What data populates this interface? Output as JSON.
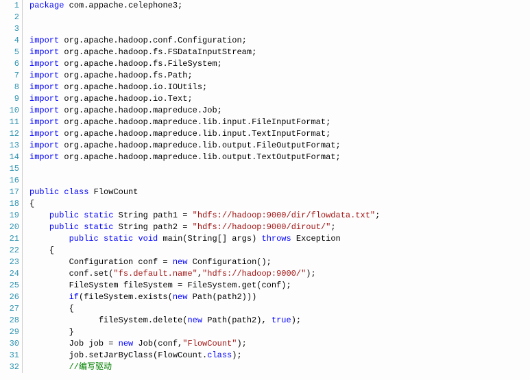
{
  "lines": [
    {
      "n": "1",
      "tokens": [
        [
          "kw",
          "package"
        ],
        [
          "id",
          " com.appache.celephone3;"
        ]
      ]
    },
    {
      "n": "2",
      "tokens": []
    },
    {
      "n": "3",
      "tokens": []
    },
    {
      "n": "4",
      "tokens": [
        [
          "kw",
          "import"
        ],
        [
          "id",
          " org.apache.hadoop.conf.Configuration;"
        ]
      ]
    },
    {
      "n": "5",
      "tokens": [
        [
          "kw",
          "import"
        ],
        [
          "id",
          " org.apache.hadoop.fs.FSDataInputStream;"
        ]
      ]
    },
    {
      "n": "6",
      "tokens": [
        [
          "kw",
          "import"
        ],
        [
          "id",
          " org.apache.hadoop.fs.FileSystem;"
        ]
      ]
    },
    {
      "n": "7",
      "tokens": [
        [
          "kw",
          "import"
        ],
        [
          "id",
          " org.apache.hadoop.fs.Path;"
        ]
      ]
    },
    {
      "n": "8",
      "tokens": [
        [
          "kw",
          "import"
        ],
        [
          "id",
          " org.apache.hadoop.io.IOUtils;"
        ]
      ]
    },
    {
      "n": "9",
      "tokens": [
        [
          "kw",
          "import"
        ],
        [
          "id",
          " org.apache.hadoop.io.Text;"
        ]
      ]
    },
    {
      "n": "10",
      "tokens": [
        [
          "kw",
          "import"
        ],
        [
          "id",
          " org.apache.hadoop.mapreduce.Job;"
        ]
      ]
    },
    {
      "n": "11",
      "tokens": [
        [
          "kw",
          "import"
        ],
        [
          "id",
          " org.apache.hadoop.mapreduce.lib.input.FileInputFormat;"
        ]
      ]
    },
    {
      "n": "12",
      "tokens": [
        [
          "kw",
          "import"
        ],
        [
          "id",
          " org.apache.hadoop.mapreduce.lib.input.TextInputFormat;"
        ]
      ]
    },
    {
      "n": "13",
      "tokens": [
        [
          "kw",
          "import"
        ],
        [
          "id",
          " org.apache.hadoop.mapreduce.lib.output.FileOutputFormat;"
        ]
      ]
    },
    {
      "n": "14",
      "tokens": [
        [
          "kw",
          "import"
        ],
        [
          "id",
          " org.apache.hadoop.mapreduce.lib.output.TextOutputFormat;"
        ]
      ]
    },
    {
      "n": "15",
      "tokens": []
    },
    {
      "n": "16",
      "tokens": []
    },
    {
      "n": "17",
      "tokens": [
        [
          "kw",
          "public"
        ],
        [
          "id",
          " "
        ],
        [
          "kw",
          "class"
        ],
        [
          "id",
          " FlowCount"
        ]
      ]
    },
    {
      "n": "18",
      "tokens": [
        [
          "id",
          "{"
        ]
      ]
    },
    {
      "n": "19",
      "tokens": [
        [
          "id",
          "    "
        ],
        [
          "kw",
          "public"
        ],
        [
          "id",
          " "
        ],
        [
          "kw",
          "static"
        ],
        [
          "id",
          " String path1 = "
        ],
        [
          "str",
          "\"hdfs://hadoop:9000/dir/flowdata.txt\""
        ],
        [
          "id",
          ";"
        ]
      ]
    },
    {
      "n": "20",
      "tokens": [
        [
          "id",
          "    "
        ],
        [
          "kw",
          "public"
        ],
        [
          "id",
          " "
        ],
        [
          "kw",
          "static"
        ],
        [
          "id",
          " String path2 = "
        ],
        [
          "str",
          "\"hdfs://hadoop:9000/dirout/\""
        ],
        [
          "id",
          ";"
        ]
      ]
    },
    {
      "n": "21",
      "tokens": [
        [
          "id",
          "        "
        ],
        [
          "kw",
          "public"
        ],
        [
          "id",
          " "
        ],
        [
          "kw",
          "static"
        ],
        [
          "id",
          " "
        ],
        [
          "kw",
          "void"
        ],
        [
          "id",
          " main(String[] args) "
        ],
        [
          "kw",
          "throws"
        ],
        [
          "id",
          " Exception"
        ]
      ]
    },
    {
      "n": "22",
      "tokens": [
        [
          "id",
          "    {"
        ]
      ]
    },
    {
      "n": "23",
      "tokens": [
        [
          "id",
          "        Configuration conf = "
        ],
        [
          "kw",
          "new"
        ],
        [
          "id",
          " Configuration();"
        ]
      ]
    },
    {
      "n": "24",
      "tokens": [
        [
          "id",
          "        conf.set("
        ],
        [
          "str",
          "\"fs.default.name\""
        ],
        [
          "id",
          ","
        ],
        [
          "str",
          "\"hdfs://hadoop:9000/\""
        ],
        [
          "id",
          ");"
        ]
      ]
    },
    {
      "n": "25",
      "tokens": [
        [
          "id",
          "        FileSystem fileSystem = FileSystem.get(conf);"
        ]
      ]
    },
    {
      "n": "26",
      "tokens": [
        [
          "id",
          "        "
        ],
        [
          "kw",
          "if"
        ],
        [
          "id",
          "(fileSystem.exists("
        ],
        [
          "kw",
          "new"
        ],
        [
          "id",
          " Path(path2)))"
        ]
      ]
    },
    {
      "n": "27",
      "tokens": [
        [
          "id",
          "        {"
        ]
      ]
    },
    {
      "n": "28",
      "tokens": [
        [
          "id",
          "              fileSystem.delete("
        ],
        [
          "kw",
          "new"
        ],
        [
          "id",
          " Path(path2), "
        ],
        [
          "kw",
          "true"
        ],
        [
          "id",
          ");"
        ]
      ]
    },
    {
      "n": "29",
      "tokens": [
        [
          "id",
          "        }"
        ]
      ]
    },
    {
      "n": "30",
      "tokens": [
        [
          "id",
          "        Job job = "
        ],
        [
          "kw",
          "new"
        ],
        [
          "id",
          " Job(conf,"
        ],
        [
          "str",
          "\"FlowCount\""
        ],
        [
          "id",
          ");"
        ]
      ]
    },
    {
      "n": "31",
      "tokens": [
        [
          "id",
          "        job.setJarByClass(FlowCount."
        ],
        [
          "kw",
          "class"
        ],
        [
          "id",
          ");"
        ]
      ]
    },
    {
      "n": "32",
      "tokens": [
        [
          "id",
          "        "
        ],
        [
          "com",
          "//编写驱动"
        ]
      ]
    }
  ]
}
